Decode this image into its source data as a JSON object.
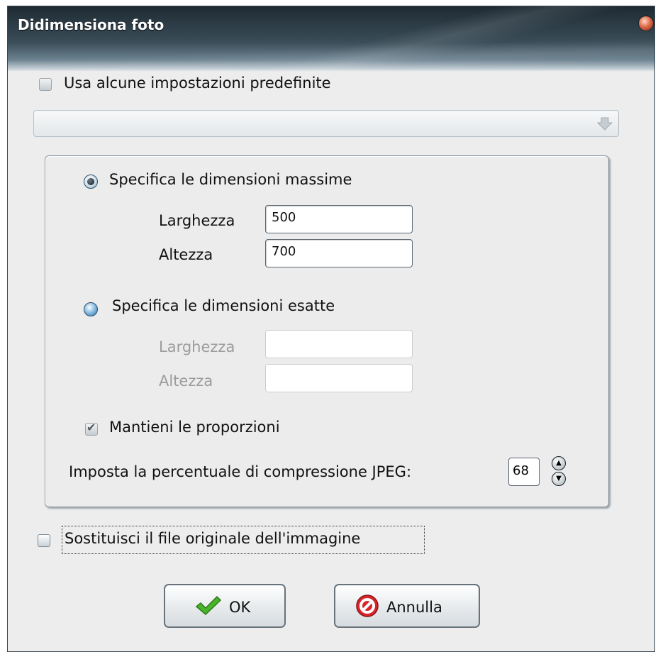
{
  "window": {
    "title": "Didimensiona foto"
  },
  "presets": {
    "checkbox_label": "Usa alcune impostazioni predefinite",
    "checked": false,
    "combo_value": ""
  },
  "max_dims": {
    "radio_label": "Specifica le dimensioni massime",
    "selected": true,
    "width_label": "Larghezza",
    "width_value": "500",
    "height_label": "Altezza",
    "height_value": "700"
  },
  "exact_dims": {
    "radio_label": "Specifica le dimensioni esatte",
    "selected": false,
    "width_label": "Larghezza",
    "width_value": "",
    "height_label": "Altezza",
    "height_value": ""
  },
  "keep_proportions": {
    "label": "Mantieni le proporzioni",
    "checked": true
  },
  "jpeg": {
    "label": "Imposta la percentuale di compressione JPEG:",
    "value": "68"
  },
  "replace_original": {
    "label": "Sostituisci il file originale dell'immagine",
    "checked": false
  },
  "buttons": {
    "ok": "OK",
    "cancel": "Annulla"
  },
  "icons": {
    "ok": "checkmark-icon",
    "cancel": "no-entry-icon",
    "close": "close-orb-icon",
    "combo": "down-arrow-icon"
  }
}
